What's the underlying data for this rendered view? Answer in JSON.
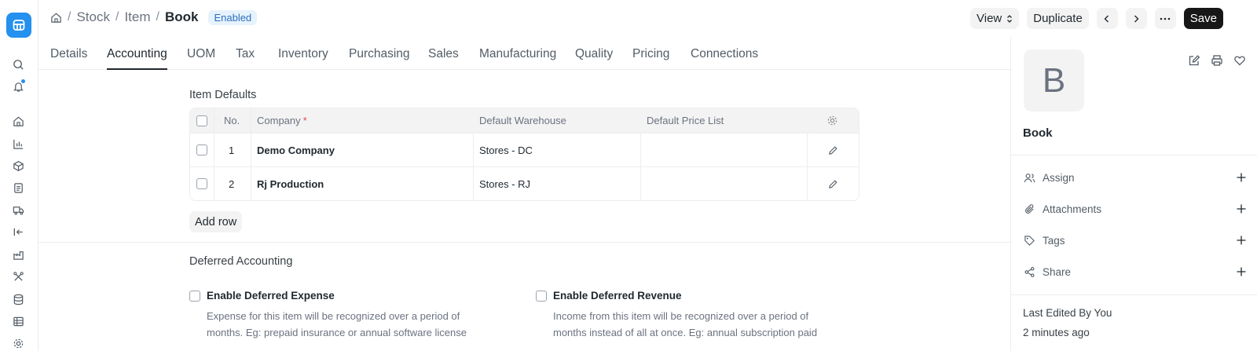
{
  "breadcrumb": {
    "level1": "Stock",
    "level2": "Item",
    "current": "Book",
    "status": "Enabled"
  },
  "actions": {
    "view": "View",
    "duplicate": "Duplicate",
    "save": "Save"
  },
  "tabs": [
    "Details",
    "Accounting",
    "UOM",
    "Tax",
    "Inventory",
    "Purchasing",
    "Sales",
    "Manufacturing",
    "Quality",
    "Pricing",
    "Connections"
  ],
  "active_tab": "Accounting",
  "item_defaults": {
    "title": "Item Defaults",
    "columns": {
      "no": "No.",
      "company": "Company",
      "warehouse": "Default Warehouse",
      "price_list": "Default Price List"
    },
    "rows": [
      {
        "no": "1",
        "company": "Demo Company",
        "warehouse": "Stores - DC",
        "price_list": ""
      },
      {
        "no": "2",
        "company": "Rj Production",
        "warehouse": "Stores - RJ",
        "price_list": ""
      }
    ],
    "add_row": "Add row"
  },
  "deferred": {
    "title": "Deferred Accounting",
    "expense": {
      "label": "Enable Deferred Expense",
      "description": "Expense for this item will be recognized over a period of months. Eg: prepaid insurance or annual software license"
    },
    "revenue": {
      "label": "Enable Deferred Revenue",
      "description": "Income from this item will be recognized over a period of months instead of all at once. Eg: annual subscription paid"
    }
  },
  "sidebar": {
    "avatar_letter": "B",
    "item_name": "Book",
    "rows": {
      "assign": "Assign",
      "attachments": "Attachments",
      "tags": "Tags",
      "share": "Share"
    },
    "last_edited": "Last Edited By You",
    "time_ago": "2 minutes ago"
  },
  "colors": {
    "accent": "#2490ef",
    "primary_button": "#171717",
    "badge_bg": "#e6f2fc",
    "badge_text": "#2d6fbf"
  }
}
